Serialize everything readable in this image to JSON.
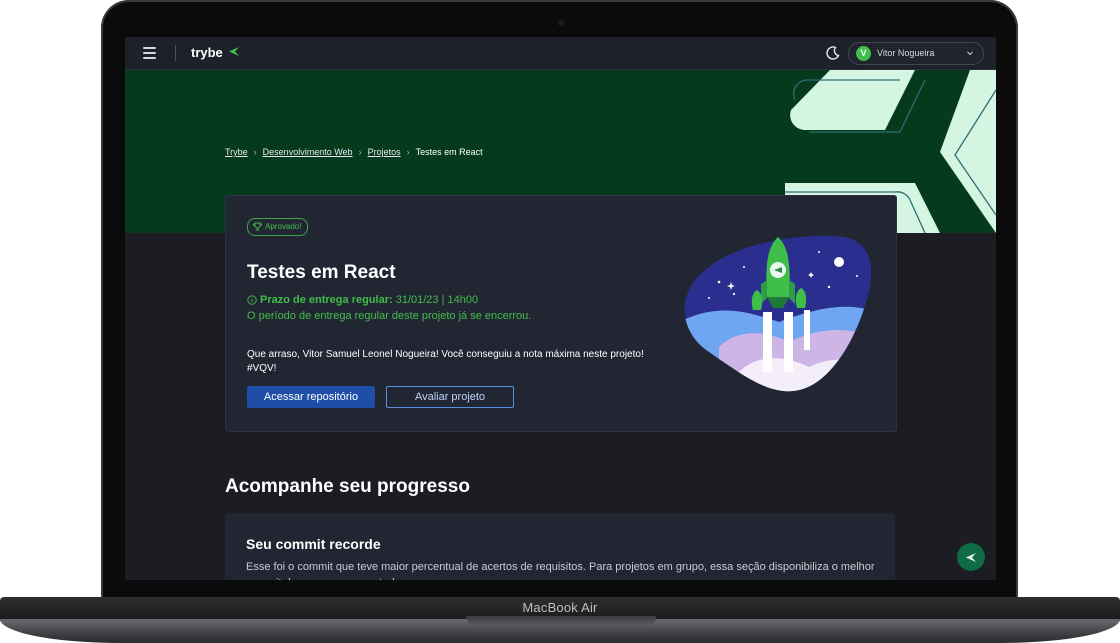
{
  "device": {
    "model_label": "MacBook Air"
  },
  "header": {
    "brand": "trybe",
    "user": {
      "initial": "V",
      "name": "Vitor Nogueira"
    }
  },
  "breadcrumb": {
    "items": [
      "Trybe",
      "Desenvolvimento Web",
      "Projetos"
    ],
    "current": "Testes em React"
  },
  "project": {
    "badge": "Aprovado!",
    "title": "Testes em React",
    "deadline_label": "Prazo de entrega regular:",
    "deadline_value": "31/01/23 | 14h00",
    "deadline_note": "O período de entrega regular deste projeto já se encerrou.",
    "congrats_line1": "Que arraso, Vitor Samuel Leonel Nogueira! Você conseguiu a nota máxima neste projeto!",
    "congrats_line2": "#VQV!",
    "primary_button": "Acessar repositório",
    "secondary_button": "Avaliar projeto"
  },
  "progress": {
    "section_title": "Acompanhe seu progresso",
    "record_title": "Seu commit recorde",
    "record_description": "Esse foi o commit que teve maior percentual de acertos de requisitos. Para projetos em grupo, essa seção disponibiliza o melhor commit do grupo como um todo."
  },
  "colors": {
    "accent_green": "#3fbf4a",
    "hero_bg": "#063a1d",
    "primary_blue": "#1d4fa8",
    "page_bg": "#1b1d22",
    "card_bg": "#222633"
  },
  "icons": [
    "menu-icon",
    "trybe-logo-icon",
    "moon-icon",
    "chevron-down-icon",
    "trophy-icon",
    "info-icon",
    "trybe-fab-icon"
  ]
}
